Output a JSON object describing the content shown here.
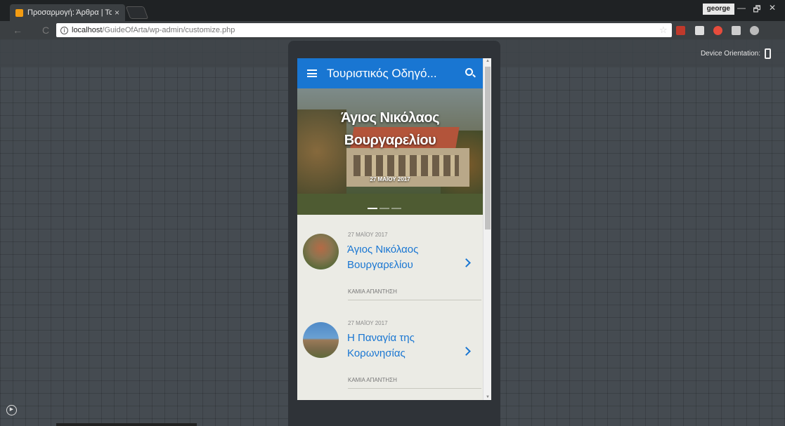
{
  "browser": {
    "tab_title": "Προσαρμογή: Άρθρα | Το",
    "tab_close": "×",
    "profile": "george",
    "win_min": "—",
    "win_max": "🗗",
    "win_close": "✕",
    "url_info": "i",
    "url_host": "localhost",
    "url_path": "/GuideOfArta/wp-admin/customize.php",
    "star": "☆",
    "back": "←",
    "reload": "C"
  },
  "customizer": {
    "device_orientation_label": "Device Orientation:"
  },
  "site": {
    "title": "Τουριστικός Οδηγό...",
    "hero": {
      "title_line1": "Άγιος Νικόλαος",
      "title_line2": "Βουργαρελίου",
      "date": "27 ΜΑΪΟΥ 2017"
    },
    "posts": [
      {
        "date": "27 ΜΑΪΟΥ 2017",
        "title_line1": "Άγιος Νικόλαος",
        "title_line2": "Βουργαρελίου",
        "comments": "ΚΑΜΙΑ ΑΠΑΝΤΗΣΗ"
      },
      {
        "date": "27 ΜΑΪΟΥ 2017",
        "title_line1": "Η Παναγία της",
        "title_line2": "Κορωνησίας",
        "comments": "ΚΑΜΙΑ ΑΠΑΝΤΗΣΗ"
      }
    ]
  },
  "colors": {
    "accent": "#1976d2",
    "background": "#454b51"
  }
}
